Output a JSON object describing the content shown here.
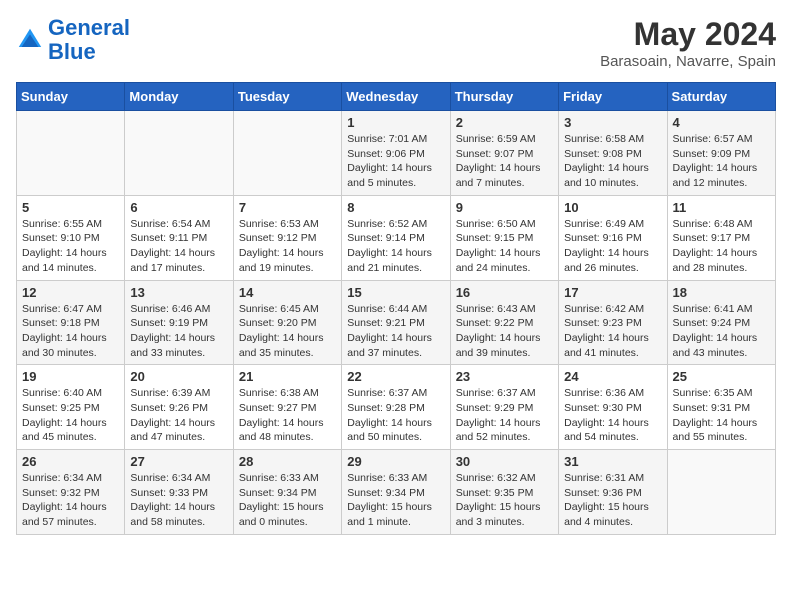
{
  "header": {
    "logo_line1": "General",
    "logo_line2": "Blue",
    "month_title": "May 2024",
    "location": "Barasoain, Navarre, Spain"
  },
  "days_of_week": [
    "Sunday",
    "Monday",
    "Tuesday",
    "Wednesday",
    "Thursday",
    "Friday",
    "Saturday"
  ],
  "weeks": [
    [
      {
        "day": "",
        "info": ""
      },
      {
        "day": "",
        "info": ""
      },
      {
        "day": "",
        "info": ""
      },
      {
        "day": "1",
        "info": "Sunrise: 7:01 AM\nSunset: 9:06 PM\nDaylight: 14 hours\nand 5 minutes."
      },
      {
        "day": "2",
        "info": "Sunrise: 6:59 AM\nSunset: 9:07 PM\nDaylight: 14 hours\nand 7 minutes."
      },
      {
        "day": "3",
        "info": "Sunrise: 6:58 AM\nSunset: 9:08 PM\nDaylight: 14 hours\nand 10 minutes."
      },
      {
        "day": "4",
        "info": "Sunrise: 6:57 AM\nSunset: 9:09 PM\nDaylight: 14 hours\nand 12 minutes."
      }
    ],
    [
      {
        "day": "5",
        "info": "Sunrise: 6:55 AM\nSunset: 9:10 PM\nDaylight: 14 hours\nand 14 minutes."
      },
      {
        "day": "6",
        "info": "Sunrise: 6:54 AM\nSunset: 9:11 PM\nDaylight: 14 hours\nand 17 minutes."
      },
      {
        "day": "7",
        "info": "Sunrise: 6:53 AM\nSunset: 9:12 PM\nDaylight: 14 hours\nand 19 minutes."
      },
      {
        "day": "8",
        "info": "Sunrise: 6:52 AM\nSunset: 9:14 PM\nDaylight: 14 hours\nand 21 minutes."
      },
      {
        "day": "9",
        "info": "Sunrise: 6:50 AM\nSunset: 9:15 PM\nDaylight: 14 hours\nand 24 minutes."
      },
      {
        "day": "10",
        "info": "Sunrise: 6:49 AM\nSunset: 9:16 PM\nDaylight: 14 hours\nand 26 minutes."
      },
      {
        "day": "11",
        "info": "Sunrise: 6:48 AM\nSunset: 9:17 PM\nDaylight: 14 hours\nand 28 minutes."
      }
    ],
    [
      {
        "day": "12",
        "info": "Sunrise: 6:47 AM\nSunset: 9:18 PM\nDaylight: 14 hours\nand 30 minutes."
      },
      {
        "day": "13",
        "info": "Sunrise: 6:46 AM\nSunset: 9:19 PM\nDaylight: 14 hours\nand 33 minutes."
      },
      {
        "day": "14",
        "info": "Sunrise: 6:45 AM\nSunset: 9:20 PM\nDaylight: 14 hours\nand 35 minutes."
      },
      {
        "day": "15",
        "info": "Sunrise: 6:44 AM\nSunset: 9:21 PM\nDaylight: 14 hours\nand 37 minutes."
      },
      {
        "day": "16",
        "info": "Sunrise: 6:43 AM\nSunset: 9:22 PM\nDaylight: 14 hours\nand 39 minutes."
      },
      {
        "day": "17",
        "info": "Sunrise: 6:42 AM\nSunset: 9:23 PM\nDaylight: 14 hours\nand 41 minutes."
      },
      {
        "day": "18",
        "info": "Sunrise: 6:41 AM\nSunset: 9:24 PM\nDaylight: 14 hours\nand 43 minutes."
      }
    ],
    [
      {
        "day": "19",
        "info": "Sunrise: 6:40 AM\nSunset: 9:25 PM\nDaylight: 14 hours\nand 45 minutes."
      },
      {
        "day": "20",
        "info": "Sunrise: 6:39 AM\nSunset: 9:26 PM\nDaylight: 14 hours\nand 47 minutes."
      },
      {
        "day": "21",
        "info": "Sunrise: 6:38 AM\nSunset: 9:27 PM\nDaylight: 14 hours\nand 48 minutes."
      },
      {
        "day": "22",
        "info": "Sunrise: 6:37 AM\nSunset: 9:28 PM\nDaylight: 14 hours\nand 50 minutes."
      },
      {
        "day": "23",
        "info": "Sunrise: 6:37 AM\nSunset: 9:29 PM\nDaylight: 14 hours\nand 52 minutes."
      },
      {
        "day": "24",
        "info": "Sunrise: 6:36 AM\nSunset: 9:30 PM\nDaylight: 14 hours\nand 54 minutes."
      },
      {
        "day": "25",
        "info": "Sunrise: 6:35 AM\nSunset: 9:31 PM\nDaylight: 14 hours\nand 55 minutes."
      }
    ],
    [
      {
        "day": "26",
        "info": "Sunrise: 6:34 AM\nSunset: 9:32 PM\nDaylight: 14 hours\nand 57 minutes."
      },
      {
        "day": "27",
        "info": "Sunrise: 6:34 AM\nSunset: 9:33 PM\nDaylight: 14 hours\nand 58 minutes."
      },
      {
        "day": "28",
        "info": "Sunrise: 6:33 AM\nSunset: 9:34 PM\nDaylight: 15 hours\nand 0 minutes."
      },
      {
        "day": "29",
        "info": "Sunrise: 6:33 AM\nSunset: 9:34 PM\nDaylight: 15 hours\nand 1 minute."
      },
      {
        "day": "30",
        "info": "Sunrise: 6:32 AM\nSunset: 9:35 PM\nDaylight: 15 hours\nand 3 minutes."
      },
      {
        "day": "31",
        "info": "Sunrise: 6:31 AM\nSunset: 9:36 PM\nDaylight: 15 hours\nand 4 minutes."
      },
      {
        "day": "",
        "info": ""
      }
    ]
  ]
}
